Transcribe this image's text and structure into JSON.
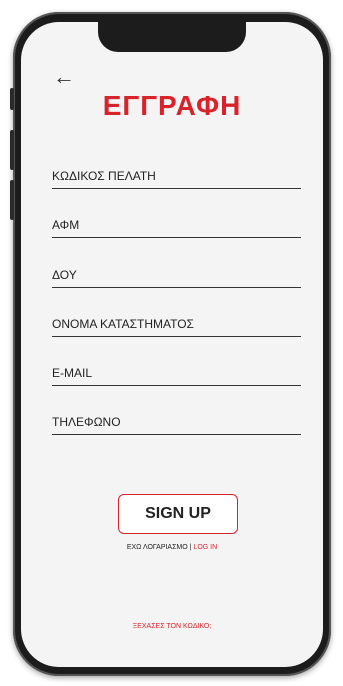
{
  "header": {
    "back_icon": "←",
    "title": "ΕΓΓΡΑΦΗ"
  },
  "form": {
    "fields": [
      {
        "label": "ΚΩΔΙΚΟΣ ΠΕΛΑΤΗ"
      },
      {
        "label": "ΑΦΜ"
      },
      {
        "label": "ΔΟΥ"
      },
      {
        "label": "ΟΝΟΜΑ ΚΑΤΑΣΤΗΜΑΤΟΣ"
      },
      {
        "label": "E-MAIL"
      },
      {
        "label": "ΤΗΛΕΦΩΝΟ"
      }
    ],
    "submit_label": "SIGN UP"
  },
  "footer": {
    "have_account": "ΕΧΩ ΛΟΓΑΡΙΑΣΜΟ |",
    "login_link": "LOG IN",
    "forgot_code": "ΞΕΧΑΣΕΣ ΤΟΝ ΚΩΔΙΚΟ;"
  },
  "colors": {
    "accent": "#d9232b",
    "text": "#222222",
    "screen_bg": "#f4f4f4"
  }
}
